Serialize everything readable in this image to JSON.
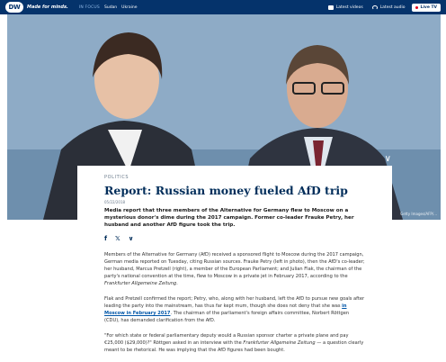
{
  "topbar": {
    "logo": "DW",
    "tagline": "Made for minds.",
    "in_focus_label": "IN FOCUS",
    "focus_links": [
      "Sudan",
      "Ukraine"
    ],
    "latest_videos": "Latest videos",
    "latest_audio": "Latest audio",
    "live_tv": "Live TV"
  },
  "hero": {
    "credit": "Getty Images/AFP/..."
  },
  "article": {
    "kicker": "POLITICS",
    "headline": "Report: Russian money fueled AfD trip",
    "date": "05/22/2018",
    "teaser": "Media report that three members of the Alternative for Germany flew to Moscow on a mysterious donor's dime during the 2017 campaign. Former co-leader Frauke Petry, her husband and another AfD figure took the trip.",
    "share_icons": [
      "facebook-icon",
      "twitter-icon",
      "more-icon"
    ],
    "p1_pre": "Members of the Alternative for Germany (AfD) received a sponsored flight to Moscow during the 2017 campaign, German media reported on Tuesday, citing Russian sources. Frauke Petry (left in photo), then the AfD's co-leader; her husband, Marcus Pretzell (right), a member of the European Parliament; and Julian Flak, the chairman of the party's national convention at the time, flew to Moscow in a private jet in February 2017, according to the ",
    "p1_em": "Frankfurter Allgemeine Zeitung",
    "p1_post": ".",
    "p2_pre": "Flak and Pretzell confirmed the report; Petry, who, along with her husband, left the AfD to pursue new goals after leading the party into the mainstream, has thus far kept mum, though she does not deny that she was ",
    "p2_link": "in Moscow in February 2017",
    "p2_post": ". The chairman of the parliament's foreign affairs committee, Norbert Röttgen (CDU), has demanded clarification from the AfD.",
    "p3_pre": "\"For which state or federal parliamentary deputy would a Russian sponsor charter a private plane and pay €25,000 ($29,000)?\" Röttgen asked in an interview with the ",
    "p3_em": "Frankfurter Allgemeine Zeitung",
    "p3_post": " — a question clearly meant to be rhetorical. He was implying that the AfD figures had been bought."
  },
  "colors": {
    "brand": "#05336b",
    "headline": "#002d5a",
    "link": "#0056a8",
    "live": "#e2001a"
  }
}
